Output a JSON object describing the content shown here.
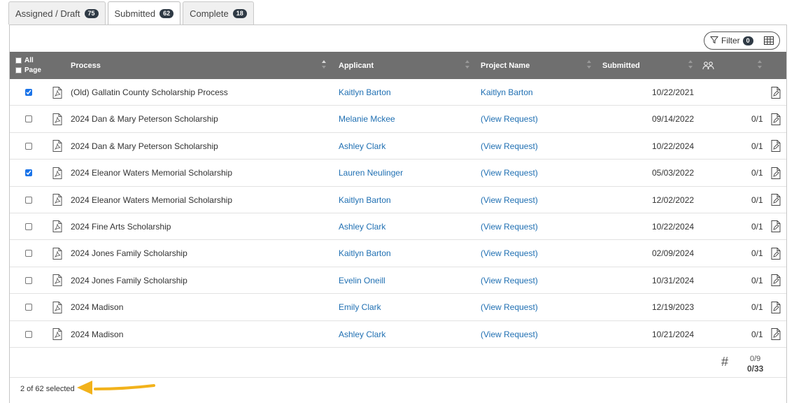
{
  "tabs": [
    {
      "label": "Assigned / Draft",
      "count": "75"
    },
    {
      "label": "Submitted",
      "count": "62"
    },
    {
      "label": "Complete",
      "count": "18"
    }
  ],
  "toolbar": {
    "filter_label": "Filter",
    "filter_count": "0"
  },
  "header": {
    "all": "All",
    "page": "Page",
    "process": "Process",
    "applicant": "Applicant",
    "project_name": "Project Name",
    "submitted": "Submitted"
  },
  "rows": [
    {
      "checked": true,
      "process": "(Old) Gallatin County Scholarship Process",
      "applicant": "Kaitlyn Barton",
      "project": "Kaitlyn Barton",
      "date": "10/22/2021",
      "count": ""
    },
    {
      "checked": false,
      "process": "2024 Dan & Mary Peterson Scholarship",
      "applicant": "Melanie Mckee",
      "project": "(View Request)",
      "date": "09/14/2022",
      "count": "0/1"
    },
    {
      "checked": false,
      "process": "2024 Dan & Mary Peterson Scholarship",
      "applicant": "Ashley Clark",
      "project": "(View Request)",
      "date": "10/22/2024",
      "count": "0/1"
    },
    {
      "checked": true,
      "process": "2024 Eleanor Waters Memorial Scholarship",
      "applicant": "Lauren Neulinger",
      "project": "(View Request)",
      "date": "05/03/2022",
      "count": "0/1"
    },
    {
      "checked": false,
      "process": "2024 Eleanor Waters Memorial Scholarship",
      "applicant": "Kaitlyn Barton",
      "project": "(View Request)",
      "date": "12/02/2022",
      "count": "0/1"
    },
    {
      "checked": false,
      "process": "2024 Fine Arts Scholarship",
      "applicant": "Ashley Clark",
      "project": "(View Request)",
      "date": "10/22/2024",
      "count": "0/1"
    },
    {
      "checked": false,
      "process": "2024 Jones Family Scholarship",
      "applicant": "Kaitlyn Barton",
      "project": "(View Request)",
      "date": "02/09/2024",
      "count": "0/1"
    },
    {
      "checked": false,
      "process": "2024 Jones Family Scholarship",
      "applicant": "Evelin Oneill",
      "project": "(View Request)",
      "date": "10/31/2024",
      "count": "0/1"
    },
    {
      "checked": false,
      "process": "2024 Madison",
      "applicant": "Emily Clark",
      "project": "(View Request)",
      "date": "12/19/2023",
      "count": "0/1"
    },
    {
      "checked": false,
      "process": "2024 Madison",
      "applicant": "Ashley Clark",
      "project": "(View Request)",
      "date": "10/21/2024",
      "count": "0/1"
    }
  ],
  "summary": {
    "hash": "#",
    "page_total": "0/9",
    "grand_total": "0/33"
  },
  "footer": {
    "selected_text": "2 of 62 selected"
  },
  "colors": {
    "header_bg": "#6f6f6f",
    "link": "#1f6fb2",
    "badge": "#2f3a45",
    "checkbox_on": "#1a73e8",
    "arrow": "#f2b21b"
  }
}
